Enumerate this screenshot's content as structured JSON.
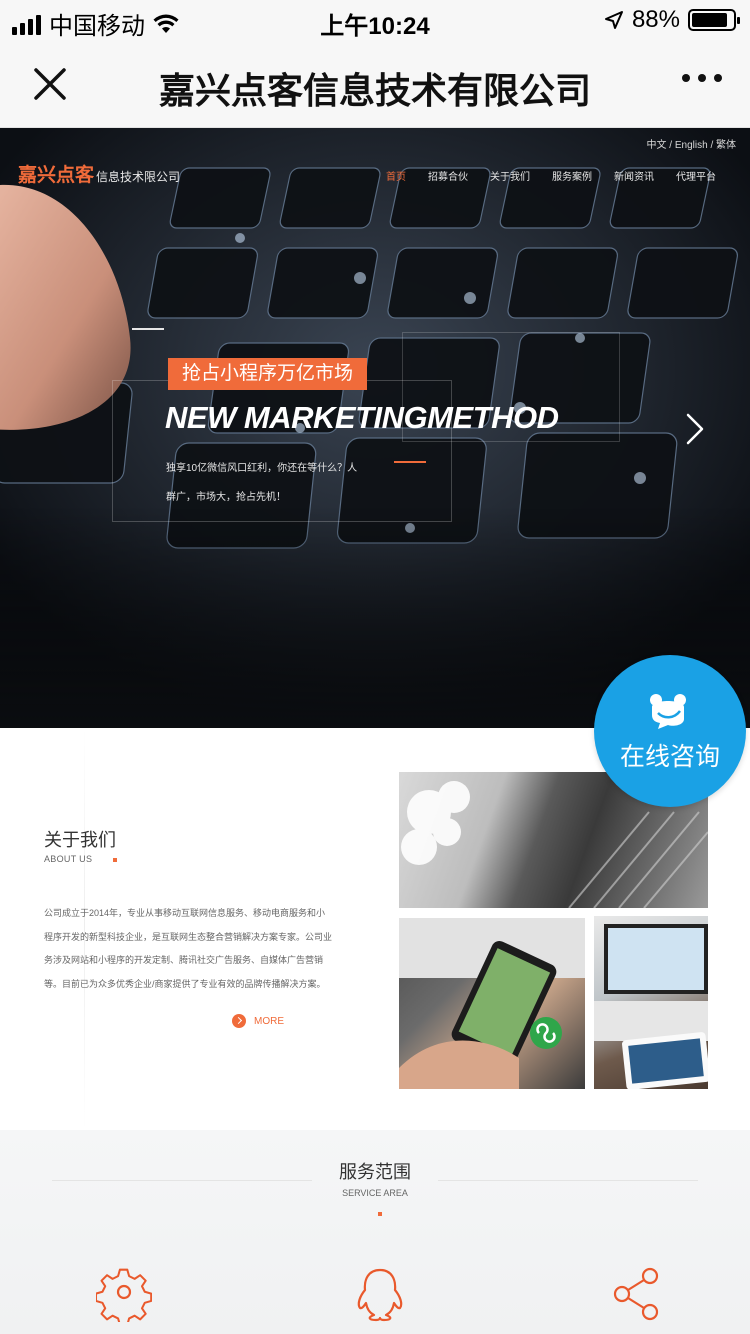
{
  "status_bar": {
    "carrier": "中国移动",
    "time": "上午10:24",
    "battery_percent": "88%",
    "battery_level": 0.88
  },
  "nav_bar": {
    "title": "嘉兴点客信息技术有限公司",
    "close_icon": "close-icon",
    "more_icon": "more-dots-icon"
  },
  "hero": {
    "lang_switch": "中文 / English / 繁体",
    "logo_main": "嘉兴点客",
    "logo_sub": "信息技术限公司",
    "menu": [
      "首页",
      "招募合伙",
      "关于我们",
      "服务案例",
      "新闻资讯",
      "代理平台"
    ],
    "tag": "抢占小程序万亿市场",
    "headline": "NEW MARKETINGMETHOD",
    "line1": "独享10亿微信风口红利，你还在等什么？人",
    "line2": "群广，市场大，抢占先机！"
  },
  "consult": {
    "label": "在线咨询",
    "icon": "bear-chat-icon",
    "color": "#1aa1e5"
  },
  "about": {
    "title": "关于我们",
    "subtitle": "ABOUT US",
    "paragraph_lines": [
      "公司成立于2014年，专业从事移动互联网信息服务、移动电商服务和小",
      "程序开发的新型科技企业，是互联网生态整合营销解决方案专家。公司业",
      "务涉及网站和小程序的开发定制、腾讯社交广告服务、自媒体广告营销",
      "等。目前已为众多优秀企业/商家提供了专业有效的品牌传播解决方案。"
    ],
    "more": "MORE"
  },
  "service": {
    "title": "服务范围",
    "subtitle": "SERVICE AREA",
    "icons": [
      "gear-icon",
      "qq-penguin-icon",
      "share-icon"
    ]
  },
  "colors": {
    "accent": "#f06b3a",
    "consult_blue": "#1aa1e5"
  }
}
